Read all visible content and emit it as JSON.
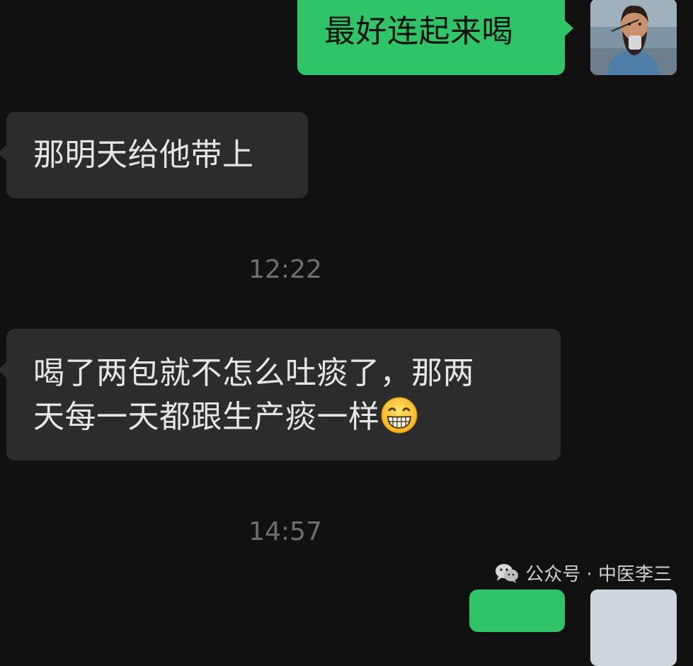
{
  "messages": [
    {
      "side": "sent",
      "text": "最好连起来喝"
    },
    {
      "side": "received",
      "text": "那明天给他带上"
    },
    {
      "timestamp": "12:22"
    },
    {
      "side": "received",
      "text_line1": "喝了两包就不怎么吐痰了，那两",
      "text_line2": "天每一天都跟生产痰一样",
      "emoji": "grinning-face-emoji"
    },
    {
      "timestamp": "14:57"
    }
  ],
  "watermark": {
    "icon": "wechat-icon",
    "text": "公众号 · 中医李三"
  },
  "colors": {
    "background": "#111111",
    "sent_bubble": "#2fc468",
    "received_bubble": "#2c2c2c",
    "timestamp": "#6f6f6f"
  }
}
